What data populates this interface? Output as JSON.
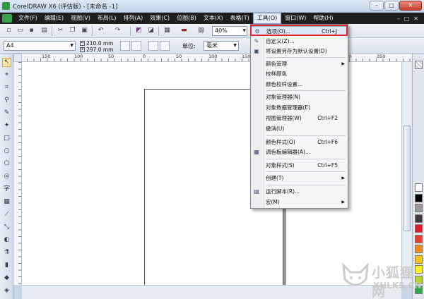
{
  "window": {
    "title": "CorelDRAW X6 (评估版) - [未命名 -1]",
    "buttons": {
      "minimize": "–",
      "restore": "□",
      "close": "✕"
    }
  },
  "menubar": {
    "items": [
      "文件(F)",
      "编辑(E)",
      "视图(V)",
      "布局(L)",
      "排列(A)",
      "效果(C)",
      "位图(B)",
      "文本(X)",
      "表格(T)",
      "工具(O)",
      "窗口(W)",
      "帮助(H)"
    ],
    "active_index": 9,
    "right_controls": [
      "–",
      "□",
      "✕"
    ]
  },
  "toolbar": {
    "zoom": "40%"
  },
  "property_bar": {
    "page_size": "A4",
    "width": "210.0 mm",
    "height": "297.0 mm",
    "unit_label": "单位:",
    "unit": "毫米"
  },
  "ruler": {
    "h_labels": [
      "150",
      "100",
      "50",
      "0",
      "50",
      "100",
      "150",
      "200",
      "250",
      "300",
      "350"
    ]
  },
  "tools_menu": {
    "items": [
      {
        "label": "选项(O)...",
        "shortcut": "Ctrl+J",
        "icon": "options-icon"
      },
      {
        "label": "自定义(Z)...",
        "shortcut": "",
        "icon": "customize-icon"
      },
      {
        "label": "将设置另存为默认设置(D)",
        "shortcut": "",
        "icon": "save-settings-icon"
      },
      {
        "label": "颜色管理",
        "shortcut": "",
        "submenu": true
      },
      {
        "label": "校样颜色",
        "shortcut": ""
      },
      {
        "label": "颜色校样设置...",
        "shortcut": ""
      },
      {
        "label": "对象管理器(N)",
        "shortcut": ""
      },
      {
        "label": "对象数据管理器(E)",
        "shortcut": ""
      },
      {
        "label": "视图管理器(W)",
        "shortcut": "Ctrl+F2"
      },
      {
        "label": "撤消(U)",
        "shortcut": ""
      },
      {
        "label": "颜色样式(O)",
        "shortcut": "Ctrl+F6"
      },
      {
        "label": "调色板编辑器(A)...",
        "shortcut": "",
        "icon": "palette-editor-icon"
      },
      {
        "label": "对象样式(S)",
        "shortcut": "Ctrl+F5"
      },
      {
        "label": "创建(T)",
        "shortcut": "",
        "submenu": true
      },
      {
        "label": "运行脚本(R)...",
        "shortcut": "",
        "icon": "run-script-icon"
      },
      {
        "label": "宏(M)",
        "shortcut": "",
        "submenu": true
      }
    ]
  },
  "palette_colors": [
    "#ffffff",
    "#000000",
    "#9a9a9a",
    "#3b3b3b",
    "#e01e2a",
    "#e83f2c",
    "#f08a1c",
    "#f5c21b",
    "#fff21e",
    "#b9d433",
    "#2fa844",
    "#1c8a5a",
    "#29a7c9",
    "#2a6fd0",
    "#1e3f9c",
    "#5a3397",
    "#9b3a9a",
    "#d83a8b",
    "#e86a9a",
    "#c9b18a",
    "#8a6a44",
    "#6e4a2e",
    "#d1d1d1",
    "#f3d7b5"
  ],
  "watermark": {
    "cn": "小狐狸网",
    "en": "XHLKS.CN"
  }
}
